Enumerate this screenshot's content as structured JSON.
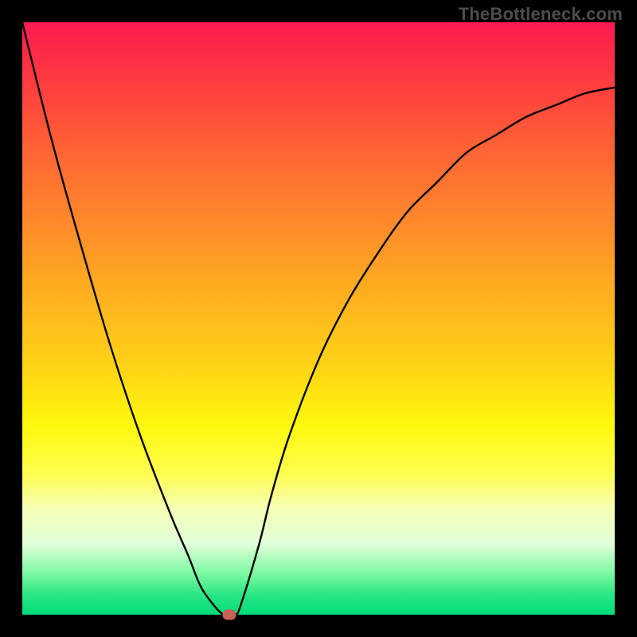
{
  "watermark": "TheBottleneck.com",
  "chart_data": {
    "type": "line",
    "title": "",
    "xlabel": "",
    "ylabel": "",
    "xlim": [
      0,
      100
    ],
    "ylim": [
      0,
      100
    ],
    "grid": false,
    "legend": false,
    "gradient_stops": [
      {
        "pos": 0,
        "color": "#ff1a51"
      },
      {
        "pos": 22,
        "color": "#ff6534"
      },
      {
        "pos": 46,
        "color": "#ffb01f"
      },
      {
        "pos": 68,
        "color": "#fff80d"
      },
      {
        "pos": 88,
        "color": "#e1ffdb"
      },
      {
        "pos": 100,
        "color": "#00dc78"
      }
    ],
    "series": [
      {
        "name": "curve",
        "x": [
          0,
          5,
          10,
          15,
          20,
          25,
          28,
          30,
          32,
          34,
          36,
          37,
          40,
          42,
          45,
          50,
          55,
          60,
          65,
          70,
          75,
          80,
          85,
          90,
          95,
          100
        ],
        "y": [
          100,
          80,
          62,
          45,
          30,
          17,
          10,
          5,
          2,
          0,
          0,
          2,
          12,
          20,
          30,
          43,
          53,
          61,
          68,
          73,
          78,
          81,
          84,
          86,
          88,
          89
        ]
      }
    ],
    "marker": {
      "x": 35,
      "y": 0,
      "color": "#c66158"
    }
  }
}
